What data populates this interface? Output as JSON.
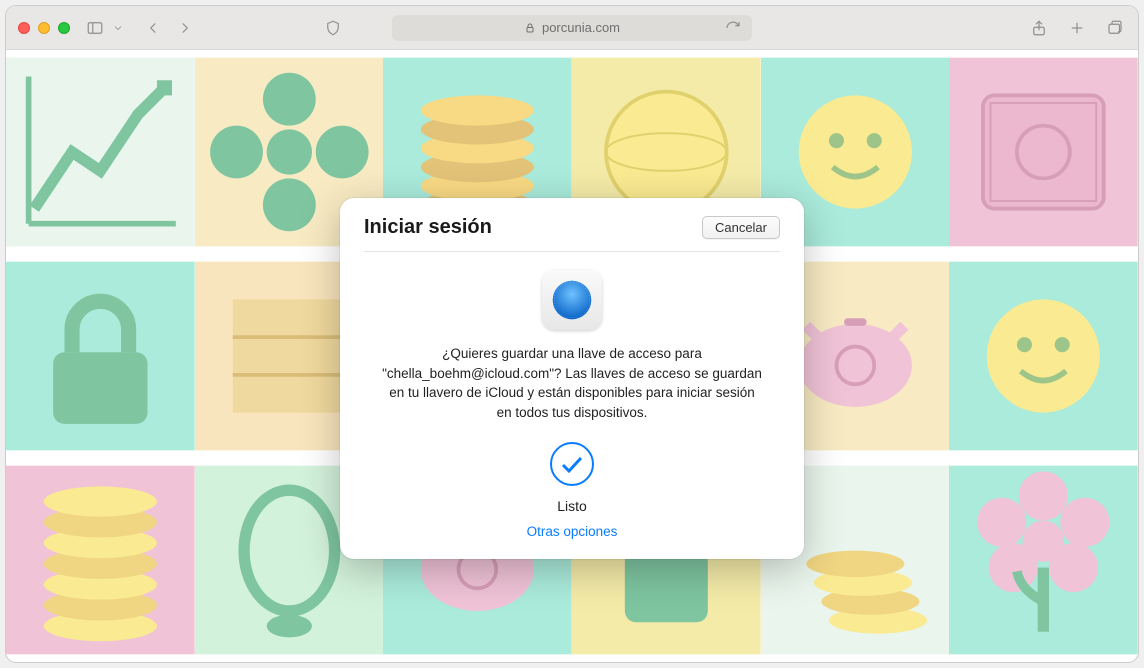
{
  "browser": {
    "url_display": "porcunia.com"
  },
  "dialog": {
    "title": "Iniciar sesión",
    "cancel_label": "Cancelar",
    "message": "¿Quieres guardar una llave de acceso para \"chella_boehm@icloud.com\"? Las llaves de acceso se guardan en tu llavero de iCloud y están disponibles para iniciar sesión en todos tus dispositivos.",
    "done_label": "Listo",
    "other_options_label": "Otras opciones"
  }
}
